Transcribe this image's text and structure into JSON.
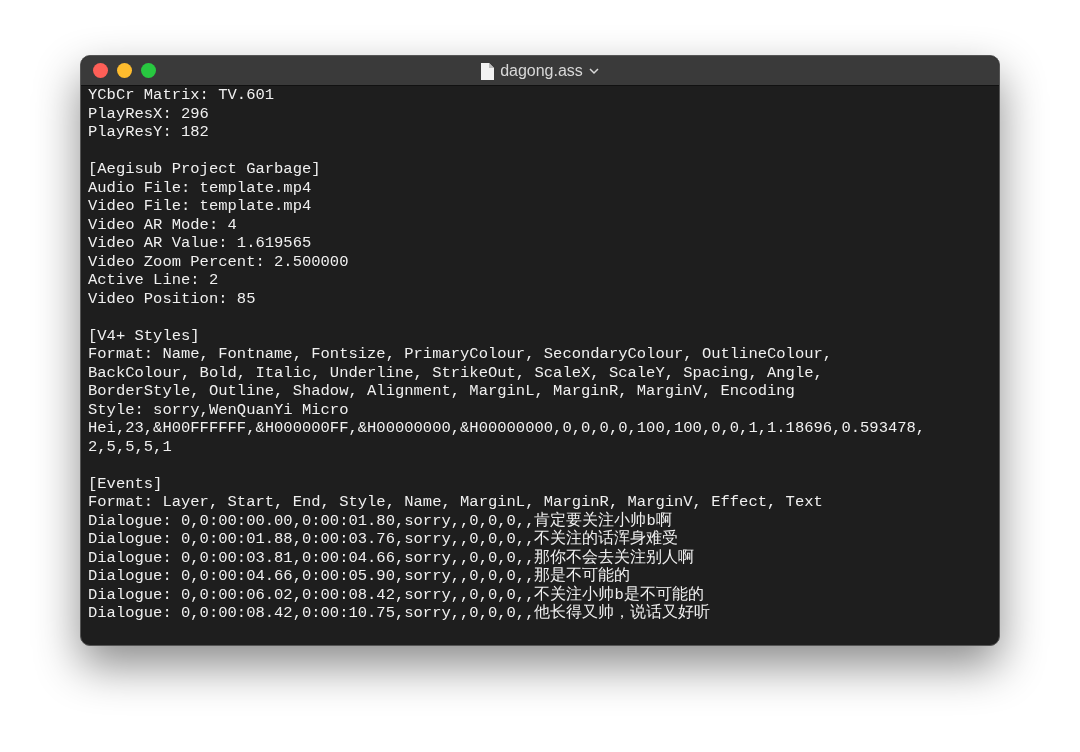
{
  "window": {
    "title": "dagong.ass"
  },
  "blocks": [
    [
      "YCbCr Matrix: TV.601",
      "PlayResX: 296",
      "PlayResY: 182"
    ],
    [
      "[Aegisub Project Garbage]",
      "Audio File: template.mp4",
      "Video File: template.mp4",
      "Video AR Mode: 4",
      "Video AR Value: 1.619565",
      "Video Zoom Percent: 2.500000",
      "Active Line: 2",
      "Video Position: 85"
    ],
    [
      "[V4+ Styles]",
      "Format: Name, Fontname, Fontsize, PrimaryColour, SecondaryColour, OutlineColour,",
      "BackColour, Bold, Italic, Underline, StrikeOut, ScaleX, ScaleY, Spacing, Angle,",
      "BorderStyle, Outline, Shadow, Alignment, MarginL, MarginR, MarginV, Encoding",
      "Style: sorry,WenQuanYi Micro",
      "Hei,23,&H00FFFFFF,&H000000FF,&H00000000,&H00000000,0,0,0,0,100,100,0,0,1,1.18696,0.593478,",
      "2,5,5,5,1"
    ],
    [
      "[Events]",
      "Format: Layer, Start, End, Style, Name, MarginL, MarginR, MarginV, Effect, Text",
      "Dialogue: 0,0:00:00.00,0:00:01.80,sorry,,0,0,0,,肯定要关注小帅b啊",
      "Dialogue: 0,0:00:01.88,0:00:03.76,sorry,,0,0,0,,不关注的话浑身难受",
      "Dialogue: 0,0:00:03.81,0:00:04.66,sorry,,0,0,0,,那你不会去关注别人啊",
      "Dialogue: 0,0:00:04.66,0:00:05.90,sorry,,0,0,0,,那是不可能的",
      "Dialogue: 0,0:00:06.02,0:00:08.42,sorry,,0,0,0,,不关注小帅b是不可能的",
      "Dialogue: 0,0:00:08.42,0:00:10.75,sorry,,0,0,0,,他长得又帅，说话又好听"
    ]
  ]
}
